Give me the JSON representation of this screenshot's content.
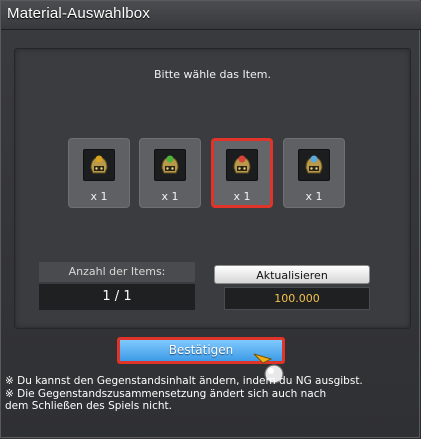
{
  "window": {
    "title": "Material-Auswahlbox"
  },
  "prompt": "Bitte wähle das Item.",
  "items": [
    {
      "qty": "x 1",
      "icon": "gold-helmet-icon",
      "gem_color": "#d9a521"
    },
    {
      "qty": "x 1",
      "icon": "green-helmet-icon",
      "gem_color": "#4bb43a"
    },
    {
      "qty": "x 1",
      "icon": "red-helmet-icon",
      "gem_color": "#d8403a",
      "selected": true
    },
    {
      "qty": "x 1",
      "icon": "blue-helmet-icon",
      "gem_color": "#5aa8e0"
    }
  ],
  "count": {
    "label": "Anzahl der Items:",
    "value": "1 / 1"
  },
  "refresh": {
    "label": "Aktualisieren",
    "price": "100.000"
  },
  "confirm": {
    "label": "Bestätigen"
  },
  "notes": [
    "※ Du kannst den Gegenstandsinhalt ändern, indem du NG ausgibst.",
    "※ Die Gegenstandszusammensetzung ändert sich auch nach",
    "dem Schließen des Spiels nicht."
  ],
  "colors": {
    "selection_border": "#e0332a",
    "confirm_button": "#3e9be6",
    "price_text": "#f3c24a"
  }
}
